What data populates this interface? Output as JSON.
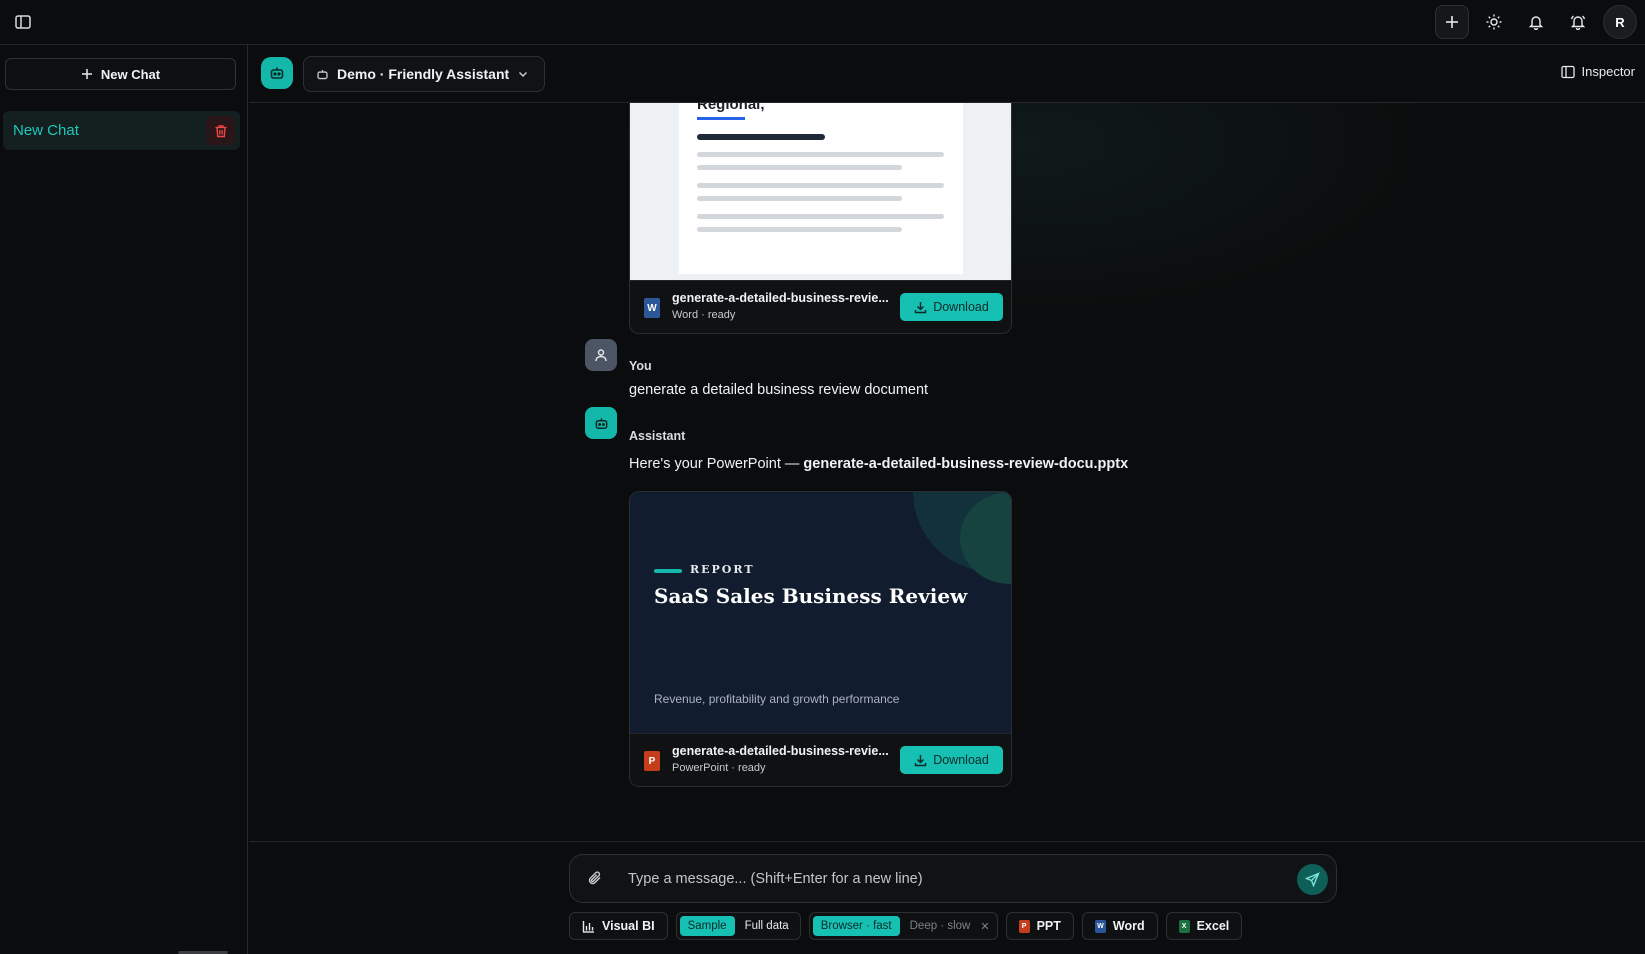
{
  "topbar": {
    "avatar_initial": "R"
  },
  "sidebar": {
    "new_chat_label": "New Chat",
    "chats": [
      {
        "title": "New Chat"
      }
    ]
  },
  "header": {
    "assistant_name": "Demo · Friendly Assistant",
    "inspector_label": "Inspector"
  },
  "messages": {
    "doc_card": {
      "preview_title": "Regional,",
      "file_name": "generate-a-detailed-business-revie...",
      "file_sub": "Word · ready",
      "download_label": "Download"
    },
    "user": {
      "role": "You",
      "text": "generate a detailed business review document"
    },
    "assistant": {
      "role": "Assistant",
      "text_prefix": "Here's your PowerPoint — ",
      "text_file": "generate-a-detailed-business-review-docu.pptx"
    },
    "ppt_card": {
      "kicker": "REPORT",
      "title": "SaaS Sales Business Review",
      "subtitle": "Revenue, profitability and growth performance",
      "file_name": "generate-a-detailed-business-revie...",
      "file_sub": "PowerPoint · ready",
      "download_label": "Download"
    }
  },
  "composer": {
    "placeholder": "Type a message... (Shift+Enter for a new line)"
  },
  "toolbar": {
    "visual_bi": "Visual BI",
    "data_sample": "Sample",
    "data_full": "Full data",
    "mode_fast": "Browser · fast",
    "mode_deep": "Deep · slow",
    "ppt": "PPT",
    "word": "Word",
    "excel": "Excel"
  },
  "colors": {
    "accent": "#16c1b4",
    "word": "#2b579a",
    "ppt": "#c43e1c",
    "excel": "#1d6f42"
  }
}
